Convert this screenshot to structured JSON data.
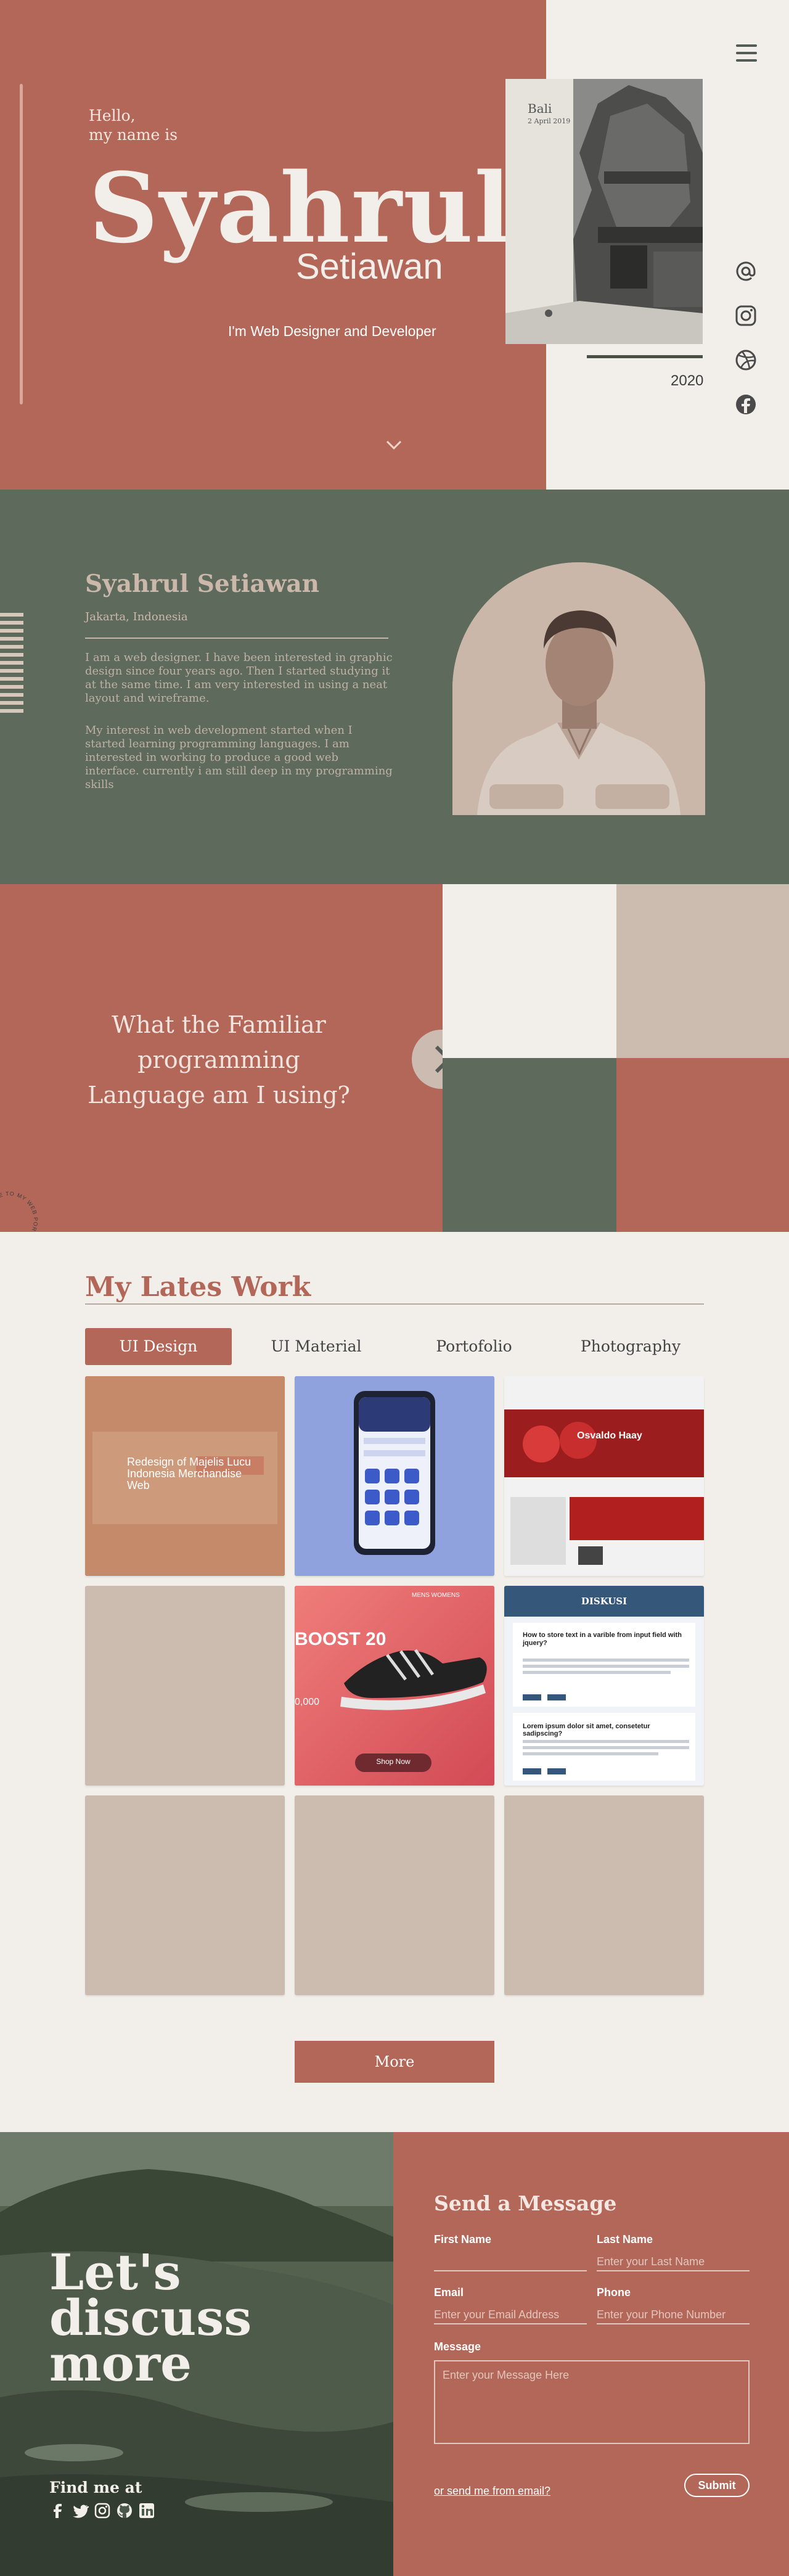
{
  "hero": {
    "greeting_line1": "Hello,",
    "greeting_line2": "my name is",
    "first_name": "Syahrul",
    "last_name": "Setiawan",
    "role": "I'm Web Designer and Developer",
    "photo_place": "Bali",
    "photo_date": "2 April 2019",
    "year": "2020",
    "social_icons": [
      "at-icon",
      "instagram-icon",
      "dribbble-icon",
      "facebook-icon"
    ]
  },
  "about": {
    "name": "Syahrul Setiawan",
    "location": "Jakarta, Indonesia",
    "paragraph1": "I am a web designer. I have been interested in graphic design since four years ago. Then I started studying it at the same time. I am very interested in using a neat layout and wireframe.",
    "paragraph2": "My interest in web development started when I started learning programming languages. I am interested in working to produce a good web interface. currently i am still deep in my programming skills"
  },
  "language": {
    "question": "What the Familiar programming Language am I using?",
    "circle_text": "WELCOME TO MY WEB PORTFOLIO"
  },
  "work": {
    "title": "My  Lates Work",
    "tabs": [
      {
        "label": "UI Design",
        "active": true
      },
      {
        "label": "UI Material",
        "active": false
      },
      {
        "label": "Portofolio",
        "active": false
      },
      {
        "label": "Photography",
        "active": false
      }
    ],
    "tile1_caption": "Redesign of Majelis Lucu Indonesia Merchandise Web",
    "tile3_heading": "Osvaldo Haay",
    "tile5_heading": "BOOST 20",
    "tile5_nav": "MENS  WOMENS",
    "tile5_price": "0,000",
    "tile5_button": "Shop Now",
    "tile6_title": "DISKUSI",
    "tile6_question": "How to store text in a varible from input field with jquery?",
    "tile6_answer": "Lorem ipsum dolor sit amet, consetetur sadipscing?",
    "more_label": "More"
  },
  "contact": {
    "headline1": "Let's",
    "headline2": "discuss",
    "headline3": "more",
    "find_me": "Find me at",
    "form_title": "Send a Message",
    "first_name_label": "First Name",
    "last_name_label": "Last Name",
    "last_name_placeholder": "Enter your Last Name",
    "email_label": "Email",
    "email_placeholder": "Enter your Email Address",
    "phone_label": "Phone",
    "phone_placeholder": "Enter your Phone Number",
    "message_label": "Message",
    "message_placeholder": "Enter your Message Here",
    "email_link": "or send me from email?",
    "submit_label": "Submit",
    "social_icons": [
      "facebook-icon",
      "twitter-icon",
      "instagram-icon",
      "github-icon",
      "linkedin-icon"
    ]
  },
  "colors": {
    "terracotta": "#b36759",
    "sage": "#5d6a5c",
    "cream": "#f2eeea",
    "taupe": "#ccbbaf"
  }
}
